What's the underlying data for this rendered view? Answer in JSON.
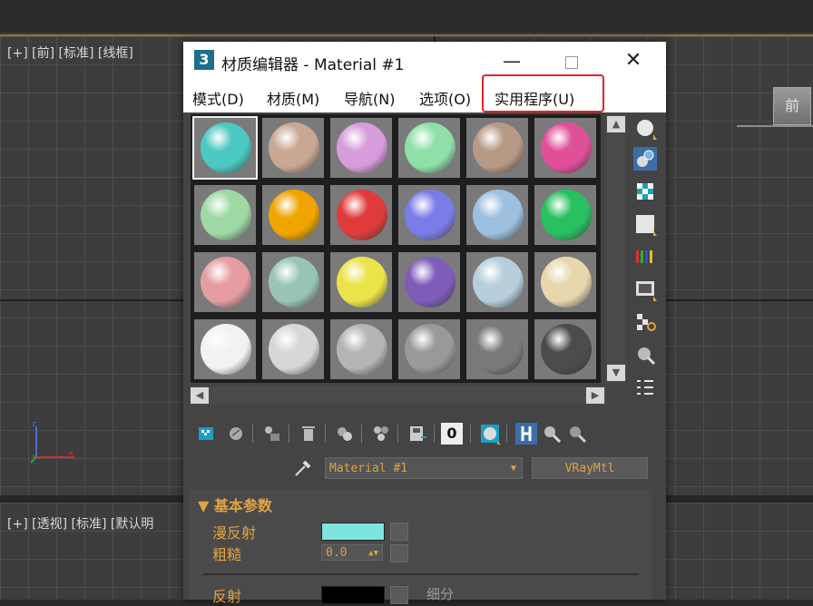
{
  "viewport": {
    "top_label": "[+] [前] [标准] [线框]",
    "bottom_label": "[+] [透视] [标准] [默认明",
    "cube_label": "前",
    "axes": {
      "x": "x",
      "y": "y",
      "z": "z"
    }
  },
  "window": {
    "icon": "3",
    "title": "材质编辑器 - Material #1",
    "minimize": "—",
    "close": "✕"
  },
  "menu": {
    "items": [
      "模式(D)",
      "材质(M)",
      "导航(N)",
      "选项(O)",
      "实用程序(U)"
    ]
  },
  "slots": {
    "colors": [
      "#4cc9c2",
      "#c9a893",
      "#d89cdc",
      "#8fe0a8",
      "#b79a86",
      "#e0509a",
      "#9ed9a4",
      "#efa400",
      "#e03b3b",
      "#7b7ce8",
      "#9dbfe0",
      "#28c060",
      "#e59da2",
      "#99c6b4",
      "#ebe34a",
      "#7e5cb8",
      "#b7cfdc",
      "#e8d7ac",
      "#f2f2f2",
      "#d7d7d7",
      "#b5b5b5",
      "#999999",
      "#7a7a7a",
      "#4c4c4c"
    ],
    "active_index": 0
  },
  "toolbar": {
    "icons": [
      "get-material-icon",
      "put-to-scene-icon",
      "assign-to-selection-icon",
      "delete-icon",
      "make-copy-icon",
      "unique-icon",
      "put-to-library-icon",
      "material-id-icon",
      "show-map-icon",
      "show-end-result-icon",
      "go-to-parent-icon",
      "go-forward-sibling-icon"
    ],
    "material_id": "0"
  },
  "side_tools": [
    "sample-type-icon",
    "backlight-icon",
    "background-icon",
    "sample-uv-icon",
    "video-color-check-icon",
    "make-preview-icon",
    "options-icon",
    "select-by-material-icon",
    "material-navigator-icon"
  ],
  "material": {
    "name": "Material #1",
    "type": "VRayMtl"
  },
  "params": {
    "rollout_title": "基本参数",
    "diffuse_label": "漫反射",
    "diffuse_color": "#7fe3df",
    "roughness_label": "粗糙",
    "roughness_value": "0.0",
    "reflect_label": "反射",
    "reflect_color": "#000000",
    "subdiv_label": "细分"
  },
  "colors": {
    "accent": "#e0a542",
    "highlight": "#e0242a"
  }
}
